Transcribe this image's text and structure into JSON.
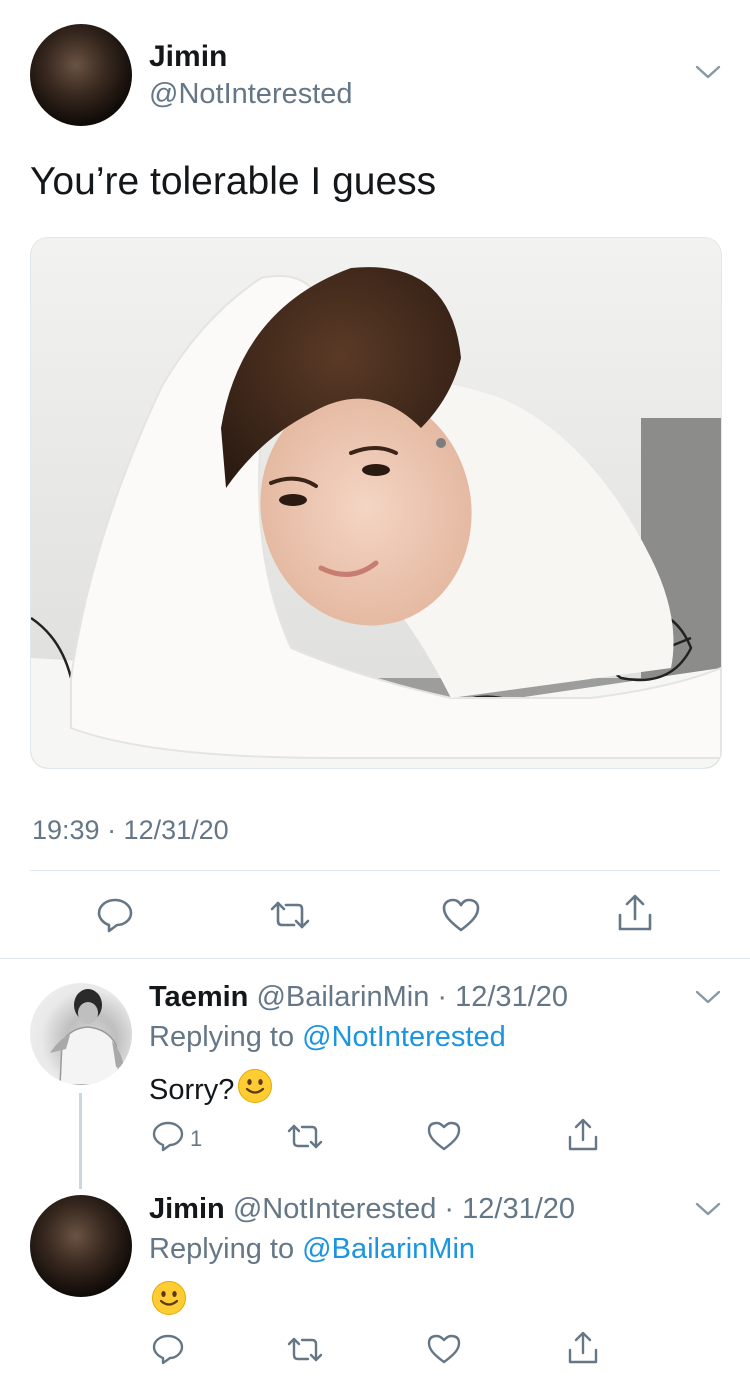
{
  "main_tweet": {
    "name": "Jimin",
    "handle": "@NotInterested",
    "text": "You’re tolerable I guess",
    "timestamp": "19:39 · 12/31/20",
    "image_alt": "photo"
  },
  "replies": [
    {
      "name": "Taemin",
      "handle": "@BailarinMin",
      "date": "· 12/31/20",
      "replying_prefix": "Replying to",
      "replying_to": "@NotInterested",
      "text": "Sorry?",
      "emoji": "🙂",
      "reply_count": "1"
    },
    {
      "name": "Jimin",
      "handle": "@NotInterested",
      "date": "· 12/31/20",
      "replying_prefix": "Replying to",
      "replying_to": "@BailarinMin",
      "emoji": "🙂"
    }
  ],
  "icons": {
    "more": "chevron-down-icon",
    "reply": "reply-icon",
    "retweet": "retweet-icon",
    "like": "heart-icon",
    "share": "share-icon"
  },
  "colors": {
    "link": "#1b95e0",
    "secondary": "#657786",
    "divider": "#e1e8ed",
    "thread_line": "#ccd6dd"
  }
}
